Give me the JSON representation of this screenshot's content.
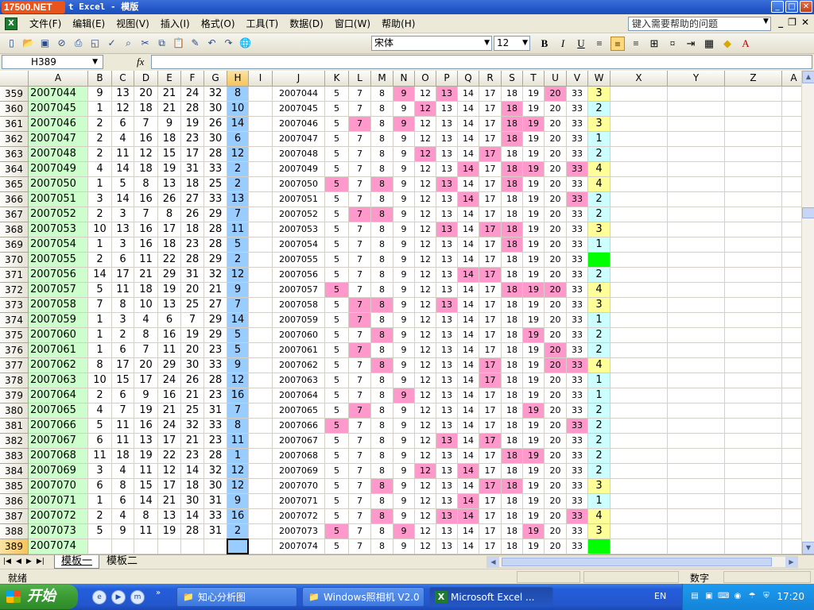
{
  "title": {
    "logo": "17500.NET",
    "text": "t Excel - 模版"
  },
  "menu": {
    "items": [
      "文件(F)",
      "编辑(E)",
      "视图(V)",
      "插入(I)",
      "格式(O)",
      "工具(T)",
      "数据(D)",
      "窗口(W)",
      "帮助(H)"
    ],
    "help_placeholder": "键入需要帮助的问题"
  },
  "toolbar": {
    "font": "宋体",
    "size": "12",
    "bold": "B",
    "italic": "I",
    "underline": "U"
  },
  "formula": {
    "namebox": "H389",
    "fx": "fx",
    "value": ""
  },
  "columns": [
    "A",
    "B",
    "C",
    "D",
    "E",
    "F",
    "G",
    "H",
    "I",
    "J",
    "K",
    "L",
    "M",
    "N",
    "O",
    "P",
    "Q",
    "R",
    "S",
    "T",
    "U",
    "V",
    "W",
    "X",
    "Y",
    "Z",
    "A"
  ],
  "right_const": [
    5,
    7,
    8,
    9,
    12,
    13,
    14,
    17,
    18,
    19,
    20,
    33
  ],
  "colors": {
    "green": "#ccffcc",
    "blue": "#99ccff",
    "pink": "#ff99cc",
    "yellow": "#ffff99",
    "cyan": "#ccffff",
    "brightgreen": "#00ff00"
  },
  "rows": [
    {
      "r": 359,
      "a": "2007044",
      "n": [
        9,
        13,
        20,
        21,
        24,
        32
      ],
      "h": 8,
      "j": "2007044",
      "pk": [
        3,
        5,
        10
      ],
      "w": "3",
      "wc": "yellow"
    },
    {
      "r": 360,
      "a": "2007045",
      "n": [
        1,
        12,
        18,
        21,
        28,
        30
      ],
      "h": 10,
      "j": "2007045",
      "pk": [
        4,
        8
      ],
      "w": "2",
      "wc": "cyan"
    },
    {
      "r": 361,
      "a": "2007046",
      "n": [
        2,
        6,
        7,
        9,
        19,
        26
      ],
      "h": 14,
      "j": "2007046",
      "pk": [
        1,
        3,
        8,
        9
      ],
      "w": "3",
      "wc": "yellow"
    },
    {
      "r": 362,
      "a": "2007047",
      "n": [
        2,
        4,
        16,
        18,
        23,
        30
      ],
      "h": 6,
      "j": "2007047",
      "pk": [
        8
      ],
      "w": "1",
      "wc": "cyan"
    },
    {
      "r": 363,
      "a": "2007048",
      "n": [
        2,
        11,
        12,
        15,
        17,
        28
      ],
      "h": 12,
      "j": "2007048",
      "pk": [
        4,
        7
      ],
      "w": "2",
      "wc": "cyan"
    },
    {
      "r": 364,
      "a": "2007049",
      "n": [
        4,
        14,
        18,
        19,
        31,
        33
      ],
      "h": 2,
      "j": "2007049",
      "pk": [
        6,
        8,
        9,
        11
      ],
      "w": "4",
      "wc": "yellow"
    },
    {
      "r": 365,
      "a": "2007050",
      "n": [
        1,
        5,
        8,
        13,
        18,
        25
      ],
      "h": 2,
      "j": "2007050",
      "pk": [
        0,
        2,
        5,
        8
      ],
      "w": "4",
      "wc": "yellow"
    },
    {
      "r": 366,
      "a": "2007051",
      "n": [
        3,
        14,
        16,
        26,
        27,
        33
      ],
      "h": 13,
      "j": "2007051",
      "pk": [
        6,
        11
      ],
      "w": "2",
      "wc": "cyan"
    },
    {
      "r": 367,
      "a": "2007052",
      "n": [
        2,
        3,
        7,
        8,
        26,
        29
      ],
      "h": 7,
      "j": "2007052",
      "pk": [
        1,
        2
      ],
      "w": "2",
      "wc": "cyan"
    },
    {
      "r": 368,
      "a": "2007053",
      "n": [
        10,
        13,
        16,
        17,
        18,
        28
      ],
      "h": 11,
      "j": "2007053",
      "pk": [
        5,
        7,
        8
      ],
      "w": "3",
      "wc": "yellow"
    },
    {
      "r": 369,
      "a": "2007054",
      "n": [
        1,
        3,
        16,
        18,
        23,
        28
      ],
      "h": 5,
      "j": "2007054",
      "pk": [
        8
      ],
      "w": "1",
      "wc": "cyan"
    },
    {
      "r": 370,
      "a": "2007055",
      "n": [
        2,
        6,
        11,
        22,
        28,
        29
      ],
      "h": 2,
      "j": "2007055",
      "pk": [],
      "w": "",
      "wc": "brightgreen"
    },
    {
      "r": 371,
      "a": "2007056",
      "n": [
        14,
        17,
        21,
        29,
        31,
        32
      ],
      "h": 12,
      "j": "2007056",
      "pk": [
        6,
        7
      ],
      "w": "2",
      "wc": "cyan"
    },
    {
      "r": 372,
      "a": "2007057",
      "n": [
        5,
        11,
        18,
        19,
        20,
        21
      ],
      "h": 9,
      "j": "2007057",
      "pk": [
        0,
        8,
        9,
        10
      ],
      "w": "4",
      "wc": "yellow"
    },
    {
      "r": 373,
      "a": "2007058",
      "n": [
        7,
        8,
        10,
        13,
        25,
        27
      ],
      "h": 7,
      "j": "2007058",
      "pk": [
        1,
        2,
        5
      ],
      "w": "3",
      "wc": "yellow"
    },
    {
      "r": 374,
      "a": "2007059",
      "n": [
        1,
        3,
        4,
        6,
        7,
        29
      ],
      "h": 14,
      "j": "2007059",
      "pk": [
        1
      ],
      "w": "1",
      "wc": "cyan"
    },
    {
      "r": 375,
      "a": "2007060",
      "n": [
        1,
        2,
        8,
        16,
        19,
        29
      ],
      "h": 5,
      "j": "2007060",
      "pk": [
        2,
        9
      ],
      "w": "2",
      "wc": "cyan"
    },
    {
      "r": 376,
      "a": "2007061",
      "n": [
        1,
        6,
        7,
        11,
        20,
        23
      ],
      "h": 5,
      "j": "2007061",
      "pk": [
        1,
        10
      ],
      "w": "2",
      "wc": "cyan"
    },
    {
      "r": 377,
      "a": "2007062",
      "n": [
        8,
        17,
        20,
        29,
        30,
        33
      ],
      "h": 9,
      "j": "2007062",
      "pk": [
        2,
        7,
        10,
        11
      ],
      "w": "4",
      "wc": "yellow"
    },
    {
      "r": 378,
      "a": "2007063",
      "n": [
        10,
        15,
        17,
        24,
        26,
        28
      ],
      "h": 12,
      "j": "2007063",
      "pk": [
        7
      ],
      "w": "1",
      "wc": "cyan"
    },
    {
      "r": 379,
      "a": "2007064",
      "n": [
        2,
        6,
        9,
        16,
        21,
        23
      ],
      "h": 16,
      "j": "2007064",
      "pk": [
        3
      ],
      "w": "1",
      "wc": "cyan"
    },
    {
      "r": 380,
      "a": "2007065",
      "n": [
        4,
        7,
        19,
        21,
        25,
        31
      ],
      "h": 7,
      "j": "2007065",
      "pk": [
        1,
        9
      ],
      "w": "2",
      "wc": "cyan"
    },
    {
      "r": 381,
      "a": "2007066",
      "n": [
        5,
        11,
        16,
        24,
        32,
        33
      ],
      "h": 8,
      "j": "2007066",
      "pk": [
        0,
        11
      ],
      "w": "2",
      "wc": "cyan"
    },
    {
      "r": 382,
      "a": "2007067",
      "n": [
        6,
        11,
        13,
        17,
        21,
        23
      ],
      "h": 11,
      "j": "2007067",
      "pk": [
        5,
        7
      ],
      "w": "2",
      "wc": "cyan"
    },
    {
      "r": 383,
      "a": "2007068",
      "n": [
        11,
        18,
        19,
        22,
        23,
        28
      ],
      "h": 1,
      "j": "2007068",
      "pk": [
        8,
        9
      ],
      "w": "2",
      "wc": "cyan"
    },
    {
      "r": 384,
      "a": "2007069",
      "n": [
        3,
        4,
        11,
        12,
        14,
        32
      ],
      "h": 12,
      "j": "2007069",
      "pk": [
        4,
        6
      ],
      "w": "2",
      "wc": "cyan"
    },
    {
      "r": 385,
      "a": "2007070",
      "n": [
        6,
        8,
        15,
        17,
        18,
        30
      ],
      "h": 12,
      "j": "2007070",
      "pk": [
        2,
        7,
        8
      ],
      "w": "3",
      "wc": "yellow"
    },
    {
      "r": 386,
      "a": "2007071",
      "n": [
        1,
        6,
        14,
        21,
        30,
        31
      ],
      "h": 9,
      "j": "2007071",
      "pk": [
        6
      ],
      "w": "1",
      "wc": "cyan"
    },
    {
      "r": 387,
      "a": "2007072",
      "n": [
        2,
        4,
        8,
        13,
        14,
        33
      ],
      "h": 16,
      "j": "2007072",
      "pk": [
        2,
        5,
        6,
        11
      ],
      "w": "4",
      "wc": "yellow"
    },
    {
      "r": 388,
      "a": "2007073",
      "n": [
        5,
        9,
        11,
        19,
        28,
        31
      ],
      "h": 2,
      "j": "2007073",
      "pk": [
        0,
        3,
        9
      ],
      "w": "3",
      "wc": "yellow"
    },
    {
      "r": 389,
      "a": "2007074",
      "n": [],
      "h": "",
      "j": "2007074",
      "pk": [],
      "w": "",
      "wc": "brightgreen"
    }
  ],
  "sheets": [
    "模板一",
    "模板二"
  ],
  "status": {
    "ready": "就绪",
    "mode": "数字"
  },
  "taskbar": {
    "start": "开始",
    "tasks": [
      "知心分析图",
      "Windows照相机 V2.0",
      "Microsoft Excel ..."
    ],
    "lang": "EN",
    "clock": "17:20"
  }
}
